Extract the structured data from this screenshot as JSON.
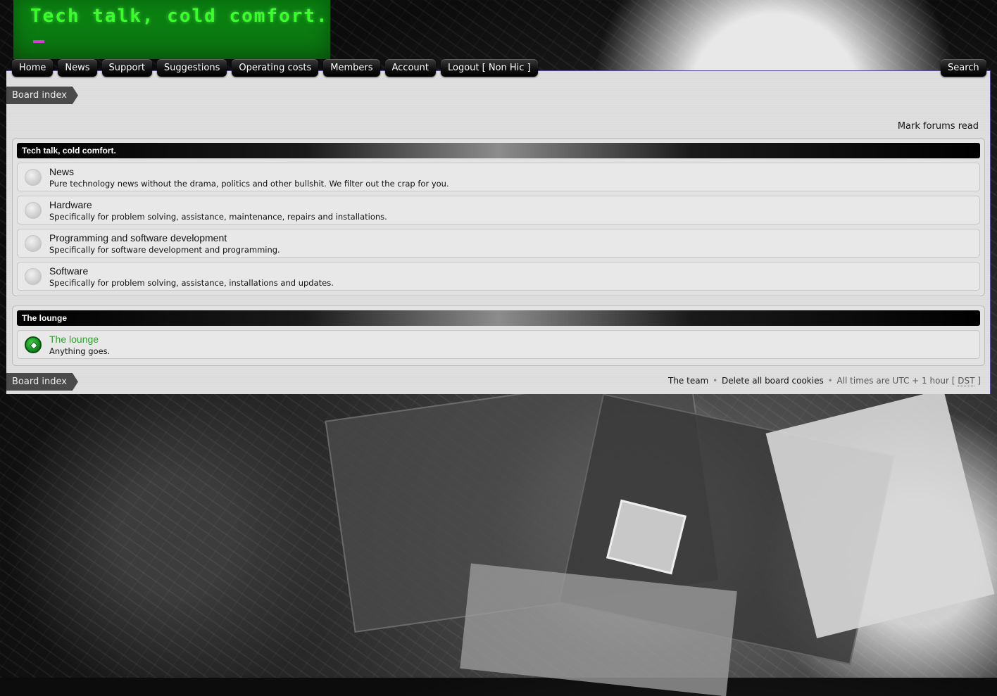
{
  "site": {
    "logo_text": "Tech talk, cold comfort."
  },
  "nav": {
    "items": [
      {
        "label": "Home"
      },
      {
        "label": "News"
      },
      {
        "label": "Support"
      },
      {
        "label": "Suggestions"
      },
      {
        "label": "Operating costs"
      },
      {
        "label": "Members"
      },
      {
        "label": "Account"
      },
      {
        "label": "Logout [ Non Hic ]"
      }
    ],
    "search_label": "Search"
  },
  "breadcrumb": {
    "label": "Board index"
  },
  "mark_forums_read": "Mark forums read",
  "groups": [
    {
      "title": "Tech talk, cold comfort.",
      "forums": [
        {
          "name": "News",
          "description": "Pure technology news without the drama, politics and other bullshit. We filter out the crap for you."
        },
        {
          "name": "Hardware",
          "description": "Specifically for problem solving, assistance, maintenance, repairs and installations."
        },
        {
          "name": "Programming and software development",
          "description": "Specifically for software development and programming."
        },
        {
          "name": "Software",
          "description": "Specifically for problem solving, assistance, installations and updates."
        }
      ]
    },
    {
      "title": "The lounge",
      "forums": [
        {
          "name": "The lounge",
          "description": "Anything goes."
        }
      ]
    }
  ],
  "footer": {
    "team": "The team",
    "separator": "•",
    "delete_cookies": "Delete all board cookies",
    "timezone_prefix": "All times are UTC + 1 hour [",
    "dst": "DST",
    "timezone_suffix": "]"
  },
  "colors": {
    "logo_green": "#39ff2a",
    "cursor_magenta": "#d43cd4",
    "unread_forum_title": "#2ea02e"
  },
  "icons": {
    "forum_read": "forum-read-icon",
    "forum_unread": "forum-unread-icon"
  }
}
